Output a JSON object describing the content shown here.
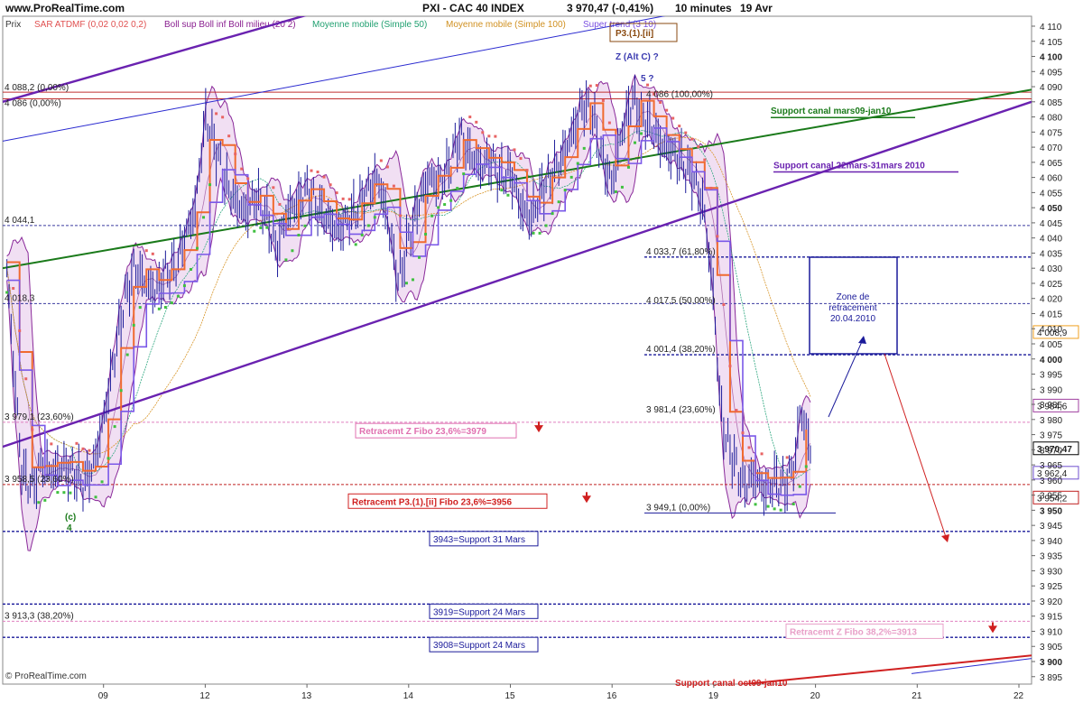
{
  "header": {
    "site": "www.ProRealTime.com",
    "instrument": "PXI - CAC 40 INDEX",
    "last_change": "3 970,47 (-0,41%)",
    "timeframe": "10 minutes",
    "date": "19 Avr"
  },
  "legend": [
    {
      "text": "Prix",
      "color": "#333333"
    },
    {
      "text": "SAR ATDMF (0,02 0,02 0,2)",
      "color": "#e05050"
    },
    {
      "text": "Boll sup Boll inf Boll milieu (20 2)",
      "color": "#8a2090"
    },
    {
      "text": "Moyenne mobile (Simple 50)",
      "color": "#20a070"
    },
    {
      "text": "Moyenne mobile (Simple 100)",
      "color": "#d09020"
    },
    {
      "text": "Super trend (3 10)",
      "color": "#7a50e0"
    }
  ],
  "copyright": "© ProRealTime.com",
  "colors": {
    "price": "#1c1c9a",
    "sar": "#e86464",
    "sar_bull": "#40c040",
    "bollinger_fill": "#f1dff3",
    "bollinger_line": "#8a2a9a",
    "ma50": "#30a880",
    "ma100": "#d8962a",
    "supertrend": "#7a58e8",
    "orange_trend": "#f06a30"
  },
  "chart_data": {
    "type": "candlestick",
    "x_tick_labels": [
      "09",
      "12",
      "13",
      "14",
      "15",
      "16",
      "19",
      "20",
      "21",
      "22"
    ],
    "y_tick_labels": [
      "4 110",
      "4 105",
      "4 100",
      "4 095",
      "4 090",
      "4 085",
      "4 080",
      "4 075",
      "4 070",
      "4 065",
      "4 060",
      "4 055",
      "4 050",
      "4 045",
      "4 040",
      "4 035",
      "4 030",
      "4 025",
      "4 020",
      "4 015",
      "4 010",
      "4 005",
      "4 000",
      "3 995",
      "3 990",
      "3 985",
      "3 980",
      "3 975",
      "3 970",
      "3 965",
      "3 960",
      "3 955",
      "3 950",
      "3 945",
      "3 940",
      "3 935",
      "3 930",
      "3 925",
      "3 920",
      "3 915",
      "3 910",
      "3 905",
      "3 900",
      "3 895"
    ],
    "y_bold_ticks": [
      "4 100",
      "4 050",
      "4 000",
      "3 950",
      "3 900"
    ],
    "ylim": [
      3892,
      4114
    ],
    "xlim": [
      0,
      10
    ],
    "price_path": [
      [
        0.05,
        4030
      ],
      [
        0.12,
        3995
      ],
      [
        0.2,
        3962
      ],
      [
        0.3,
        3958
      ],
      [
        0.4,
        3966
      ],
      [
        0.5,
        3962
      ],
      [
        0.6,
        3965
      ],
      [
        0.7,
        3963
      ],
      [
        0.8,
        3958
      ],
      [
        0.9,
        3965
      ],
      [
        1.0,
        3980
      ],
      [
        1.1,
        4000
      ],
      [
        1.2,
        4018
      ],
      [
        1.3,
        4030
      ],
      [
        1.4,
        4026
      ],
      [
        1.5,
        4022
      ],
      [
        1.6,
        4028
      ],
      [
        1.7,
        4030
      ],
      [
        1.8,
        4040
      ],
      [
        1.9,
        4050
      ],
      [
        2.0,
        4080
      ],
      [
        2.1,
        4070
      ],
      [
        2.2,
        4058
      ],
      [
        2.3,
        4052
      ],
      [
        2.4,
        4048
      ],
      [
        2.5,
        4054
      ],
      [
        2.6,
        4048
      ],
      [
        2.7,
        4035
      ],
      [
        2.8,
        4048
      ],
      [
        2.9,
        4052
      ],
      [
        3.0,
        4056
      ],
      [
        3.1,
        4050
      ],
      [
        3.2,
        4046
      ],
      [
        3.3,
        4042
      ],
      [
        3.4,
        4046
      ],
      [
        3.5,
        4050
      ],
      [
        3.6,
        4056
      ],
      [
        3.7,
        4060
      ],
      [
        3.8,
        4044
      ],
      [
        3.9,
        4025
      ],
      [
        4.0,
        4040
      ],
      [
        4.1,
        4052
      ],
      [
        4.2,
        4060
      ],
      [
        4.3,
        4058
      ],
      [
        4.4,
        4064
      ],
      [
        4.5,
        4074
      ],
      [
        4.6,
        4068
      ],
      [
        4.7,
        4063
      ],
      [
        4.8,
        4066
      ],
      [
        4.9,
        4060
      ],
      [
        5.0,
        4062
      ],
      [
        5.1,
        4050
      ],
      [
        5.2,
        4046
      ],
      [
        5.3,
        4056
      ],
      [
        5.4,
        4060
      ],
      [
        5.5,
        4066
      ],
      [
        5.6,
        4074
      ],
      [
        5.7,
        4084
      ],
      [
        5.8,
        4082
      ],
      [
        5.9,
        4066
      ],
      [
        6.0,
        4058
      ],
      [
        6.1,
        4076
      ],
      [
        6.2,
        4086
      ],
      [
        6.3,
        4080
      ],
      [
        6.4,
        4076
      ],
      [
        6.5,
        4070
      ],
      [
        6.6,
        4068
      ],
      [
        6.7,
        4064
      ],
      [
        6.8,
        4060
      ],
      [
        6.9,
        4050
      ],
      [
        7.0,
        4020
      ],
      [
        7.05,
        3990
      ],
      [
        7.1,
        3976
      ],
      [
        7.2,
        3966
      ],
      [
        7.3,
        3958
      ],
      [
        7.4,
        3962
      ],
      [
        7.5,
        3956
      ],
      [
        7.6,
        3960
      ],
      [
        7.7,
        3958
      ],
      [
        7.8,
        3966
      ],
      [
        7.85,
        3984
      ],
      [
        7.9,
        3976
      ],
      [
        7.95,
        3970.47
      ]
    ],
    "fibonacci_levels": [
      {
        "label": "4 088,2 (0,00%)",
        "value": 4088.2
      },
      {
        "label": "4 086 (0,00%)",
        "value": 4086
      },
      {
        "label": "4 044,1",
        "value": 4044.1
      },
      {
        "label": "4 018,3",
        "value": 4018.3
      },
      {
        "label": "3 979,1 (23,60%)",
        "value": 3979.1
      },
      {
        "label": "3 958,5 (23,60%)",
        "value": 3958.5
      },
      {
        "label": "3 913,3 (38,20%)",
        "value": 3913.3
      },
      {
        "label": "4 086 (100,00%)",
        "value": 4086
      },
      {
        "label": "4 033,7 (61,80%)",
        "value": 4033.7
      },
      {
        "label": "4 017,5 (50,00%)",
        "value": 4017.5
      },
      {
        "label": "4 001,4 (38,20%)",
        "value": 4001.4
      },
      {
        "label": "3 981,4 (23,60%)",
        "value": 3981.4
      },
      {
        "label": "3 949,1 (0,00%)",
        "value": 3949.1
      }
    ],
    "support_levels": [
      {
        "label": "3943=Support 31 Mars",
        "value": 3943
      },
      {
        "label": "3919=Support 24 Mars",
        "value": 3919
      },
      {
        "label": "3908=Support 24 Mars",
        "value": 3908
      }
    ],
    "retracement_annotations": [
      {
        "label": "Retracemt Z Fibo 23,6%=3979",
        "value": 3979
      },
      {
        "label": "Retracemt P3.(1).[ii] Fibo 23,6%=3956",
        "value": 3956
      },
      {
        "label": "Retracemt Z Fibo 38,2%=3913",
        "value": 3913
      }
    ],
    "channel_labels": [
      {
        "label": "Support canal mars09-jan10"
      },
      {
        "label": "Support canal 22mars-31mars 2010"
      },
      {
        "label": "Support canal oct09-jan10"
      }
    ],
    "wave_labels": [
      "P3.(1).[ii]",
      "Z (Alt C) ?",
      "5 ?",
      "(c)",
      "4"
    ],
    "zone_label": [
      "Zone de",
      "retracement",
      "20.04.2010"
    ],
    "price_badges": [
      {
        "label": "4 008,9",
        "value": 4008.9,
        "color": "#f0a020"
      },
      {
        "label": "3 984,6",
        "value": 3984.6,
        "color": "#a040a0"
      },
      {
        "label": "3 970,47",
        "value": 3970.47,
        "color": "#000000"
      },
      {
        "label": "3 962,4",
        "value": 3962.4,
        "color": "#7050d0"
      },
      {
        "label": "3 954,2",
        "value": 3954.2,
        "color": "#c02020"
      }
    ]
  }
}
